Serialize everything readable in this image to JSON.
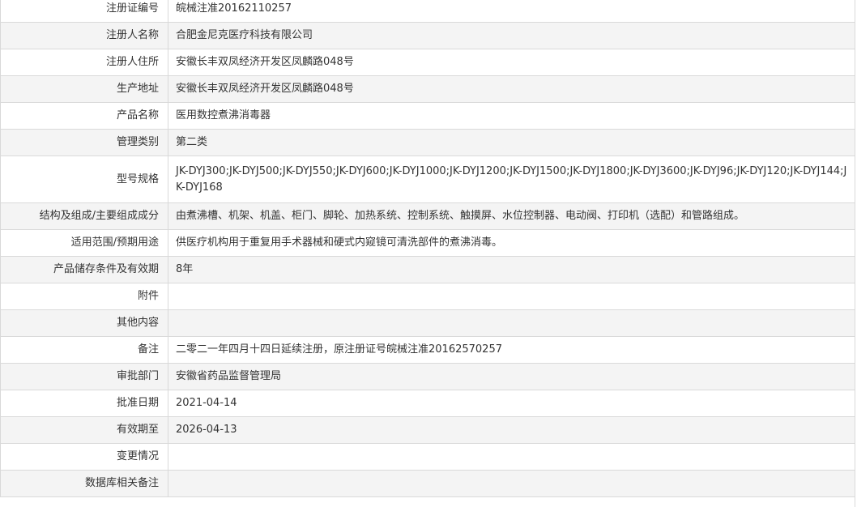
{
  "rows": [
    {
      "label": "注册证编号",
      "value": "皖械注准20162110257"
    },
    {
      "label": "注册人名称",
      "value": "合肥金尼克医疗科技有限公司"
    },
    {
      "label": "注册人住所",
      "value": "安徽长丰双凤经济开发区凤麟路048号"
    },
    {
      "label": "生产地址",
      "value": "安徽长丰双凤经济开发区凤麟路048号"
    },
    {
      "label": "产品名称",
      "value": "医用数控煮沸消毒器"
    },
    {
      "label": "管理类别",
      "value": "第二类"
    },
    {
      "label": "型号规格",
      "value": "JK-DYJ300;JK-DYJ500;JK-DYJ550;JK-DYJ600;JK-DYJ1000;JK-DYJ1200;JK-DYJ1500;JK-DYJ1800;JK-DYJ3600;JK-DYJ96;JK-DYJ120;JK-DYJ144;JK-DYJ168"
    },
    {
      "label": "结构及组成/主要组成成分",
      "value": "由煮沸槽、机架、机盖、柜门、脚轮、加热系统、控制系统、触摸屏、水位控制器、电动阀、打印机（选配）和管路组成。"
    },
    {
      "label": "适用范围/预期用途",
      "value": "供医疗机构用于重复用手术器械和硬式内窥镜可清洗部件的煮沸消毒。"
    },
    {
      "label": "产品储存条件及有效期",
      "value": "8年"
    },
    {
      "label": "附件",
      "value": ""
    },
    {
      "label": "其他内容",
      "value": ""
    },
    {
      "label": "备注",
      "value": "二零二一年四月十四日延续注册，原注册证号皖械注准20162570257"
    },
    {
      "label": "审批部门",
      "value": "安徽省药品监督管理局"
    },
    {
      "label": "批准日期",
      "value": "2021-04-14"
    },
    {
      "label": "有效期至",
      "value": "2026-04-13"
    },
    {
      "label": "变更情况",
      "value": ""
    },
    {
      "label": "数据库相关备注",
      "value": ""
    }
  ]
}
